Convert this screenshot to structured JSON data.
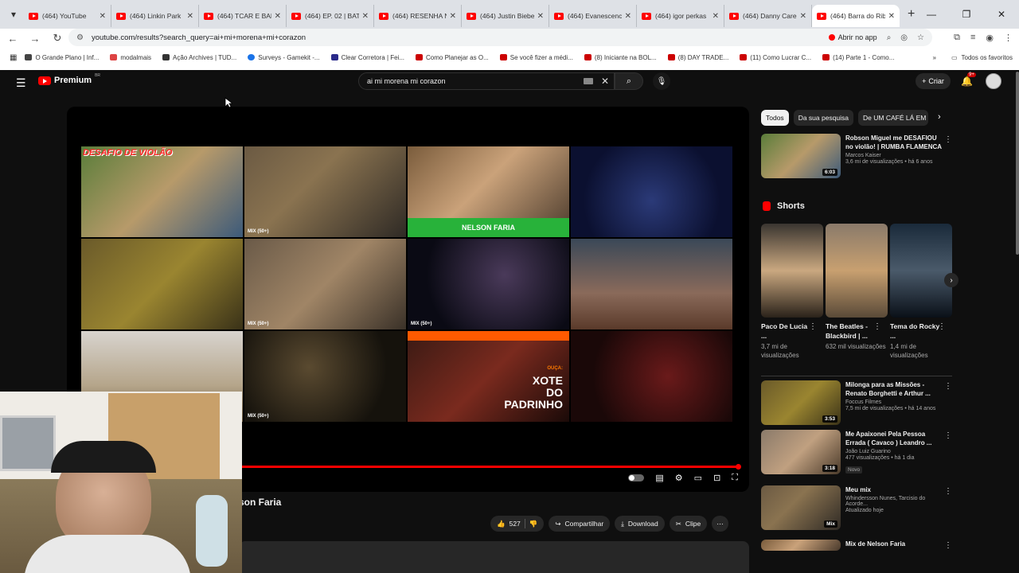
{
  "browser": {
    "tabs": [
      {
        "title": "(464) YouTube"
      },
      {
        "title": "(464) Linkin Park"
      },
      {
        "title": "(464) TCAR E BAL"
      },
      {
        "title": "(464) EP. 02 | BAT"
      },
      {
        "title": "(464) RESENHA N"
      },
      {
        "title": "(464) Justin Biebe"
      },
      {
        "title": "(464) Evanescenc"
      },
      {
        "title": "(464) igor perkas"
      },
      {
        "title": "(464) Danny Care"
      },
      {
        "title": "(464) Barra do Rib"
      }
    ],
    "url": "youtube.com/results?search_query=ai+mi+morena+mi+corazon",
    "open_in_app": "Abrir no app",
    "bookmarks": [
      {
        "label": "O Grande Plano | Inf..."
      },
      {
        "label": "modalmais"
      },
      {
        "label": "Ação Archives | TUD..."
      },
      {
        "label": "Surveys - Gamekit -..."
      },
      {
        "label": "Clear Corretora | Fei..."
      },
      {
        "label": "Como Planejar as O..."
      },
      {
        "label": "Se você fizer a médi..."
      },
      {
        "label": "(8) Iniciante na BOL..."
      },
      {
        "label": "(8) DAY TRADE..."
      },
      {
        "label": "(11) Como Lucrar C..."
      },
      {
        "label": "(14) Parte 1 - Como..."
      }
    ],
    "all_favorites": "Todos os favoritos"
  },
  "youtube": {
    "brand": "Premium",
    "brand_sup": "BR",
    "search_value": "ai mi morena mi corazon",
    "create_label": "Criar",
    "notif_count": "9+"
  },
  "player": {
    "endscreen_title": "DESAFIO DE VIOLÃO",
    "mix_label": "MIX (50+)",
    "green_band": "NELSON FARIA",
    "xote_small": "OUÇA:",
    "xote_line1": "XOTE",
    "xote_line2": "DO",
    "xote_line3": "PADRINHO",
    "progress_fraction": 0.99
  },
  "video": {
    "title_partial": "son Faria",
    "likes": "527",
    "share": "Compartilhar",
    "download": "Download",
    "clip": "Clipe"
  },
  "sidebar": {
    "chips": [
      "Todos",
      "Da sua pesquisa",
      "De UM CAFÉ LÁ EM C"
    ],
    "top_rec": {
      "title": "Robson Miguel me DESAFIOU no violão! | RUMBA FLAMENCA",
      "channel": "Marcos Kaiser",
      "stats": "3,6 mi de visualizações • há 6 anos",
      "duration": "6:03"
    },
    "shorts_title": "Shorts",
    "shorts": [
      {
        "title": "Paco De Lucia ...",
        "views": "3,7 mi de visualizações"
      },
      {
        "title": "The Beatles - Blackbird | ...",
        "views": "632 mil visualizações"
      },
      {
        "title": "Tema do Rocky ...",
        "views": "1,4 mi de visualizações"
      }
    ],
    "recs": [
      {
        "title": "Milonga para as Missões - Renato Borghetti e Arthur ...",
        "channel": "Foccus Filmes",
        "stats": "7,5 mi de visualizações • há 14 anos",
        "duration": "3:53",
        "badge": ""
      },
      {
        "title": "Me Apaixonei Pela Pessoa Errada ( Cavaco ) Leandro ...",
        "channel": "João Luiz Guarino",
        "stats": "477 visualizações • há 1 dia",
        "duration": "3:18",
        "badge": "Novo"
      },
      {
        "title": "Meu mix",
        "channel": "Whindersson Nunes, Tarcisio do Acorde...",
        "stats": "Atualizado hoje",
        "duration": "Mix",
        "badge": ""
      },
      {
        "title": "Mix de Nelson Faria",
        "channel": "",
        "stats": "",
        "duration": "",
        "badge": ""
      }
    ]
  }
}
